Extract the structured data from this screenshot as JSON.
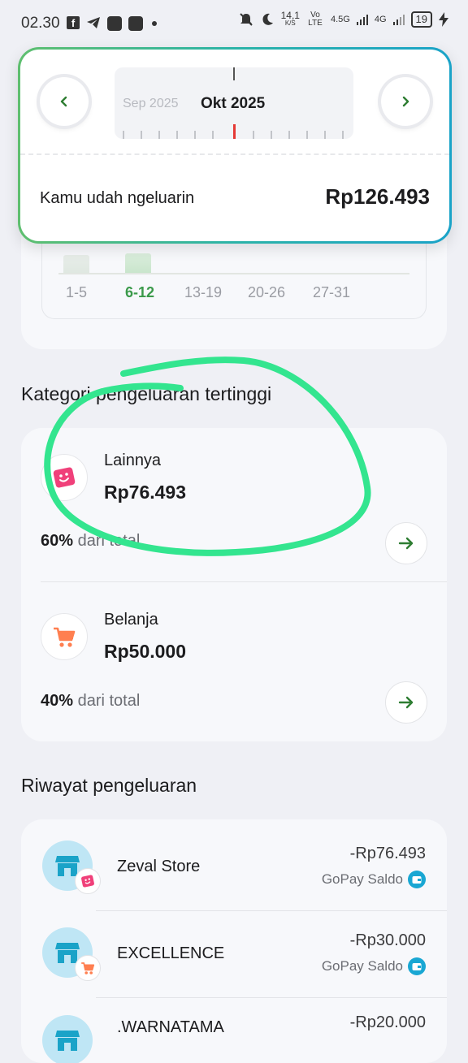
{
  "status_bar": {
    "time": "02.30",
    "speed": "14,1",
    "speed_unit": "K/S",
    "volte": "Vo LTE",
    "net1": "4.5G",
    "net2": "4G",
    "battery": "19"
  },
  "month_picker": {
    "prev_month": "Sep 2025",
    "current_month": "Okt 2025",
    "prev_icon": "chevron-left-icon",
    "next_icon": "chevron-right-icon"
  },
  "summary": {
    "label": "Kamu udah ngeluarin",
    "amount": "Rp126.493"
  },
  "weeks": [
    "1-5",
    "6-12",
    "13-19",
    "20-26",
    "27-31"
  ],
  "active_week_index": 1,
  "categories_section": {
    "title": "Kategori pengeluaran tertinggi",
    "items": [
      {
        "name": "Lainnya",
        "amount": "Rp76.493",
        "percent": "60%",
        "percent_suffix": "dari total",
        "icon": "smiley-tag-icon"
      },
      {
        "name": "Belanja",
        "amount": "Rp50.000",
        "percent": "40%",
        "percent_suffix": "dari total",
        "icon": "shopping-cart-icon"
      }
    ]
  },
  "history_section": {
    "title": "Riwayat pengeluaran",
    "items": [
      {
        "merchant": "Zeval Store",
        "amount": "-Rp76.493",
        "method": "GoPay Saldo",
        "badge_icon": "smiley-tag-icon"
      },
      {
        "merchant": "EXCELLENCE",
        "amount": "-Rp30.000",
        "method": "GoPay Saldo",
        "badge_icon": "shopping-cart-icon"
      },
      {
        "merchant": ".WARNATAMA",
        "amount": "-Rp20.000",
        "method": "",
        "badge_icon": ""
      }
    ]
  },
  "colors": {
    "accent_green": "#3b9a4a",
    "annotation_green": "#33e58f",
    "gopay_blue": "#19a7d3",
    "lainnya_pink": "#f0407a",
    "belanja_orange": "#ff7f50"
  }
}
